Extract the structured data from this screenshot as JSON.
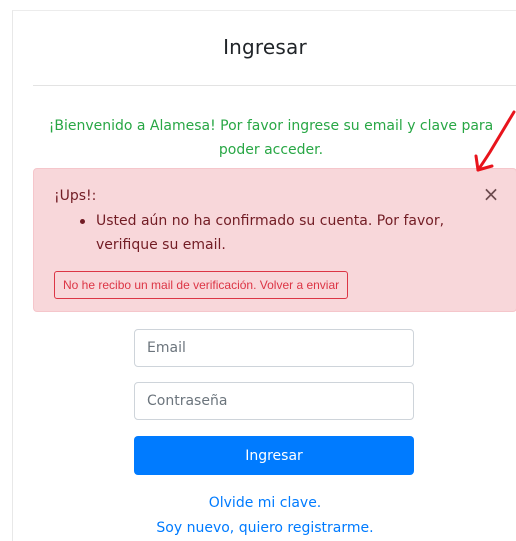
{
  "page": {
    "title": "Ingresar",
    "welcome_message": "¡Bienvenido a Alamesa! Por favor ingrese su email y clave para poder acceder."
  },
  "alert": {
    "heading": "¡Ups!:",
    "items": [
      "Usted aún no ha confirmado su cuenta. Por favor, verifique su email."
    ],
    "close_label": "×",
    "resend_link_label": "No he recibo un mail de verificación. Volver a enviar"
  },
  "form": {
    "email_placeholder": "Email",
    "email_value": "",
    "password_placeholder": "Contraseña",
    "password_value": "",
    "submit_label": "Ingresar"
  },
  "links": {
    "forgot_password": "Olvide mi clave.",
    "register": "Soy nuevo, quiero registrarme."
  },
  "colors": {
    "success_text": "#28a745",
    "danger_text": "#721c24",
    "danger_bg": "#f8d7da",
    "danger_border": "#f5c6cb",
    "primary": "#007bff",
    "annotation_arrow": "#e8141c"
  },
  "icons": {
    "close": "close-icon",
    "annotation": "annotation-arrow-icon"
  }
}
